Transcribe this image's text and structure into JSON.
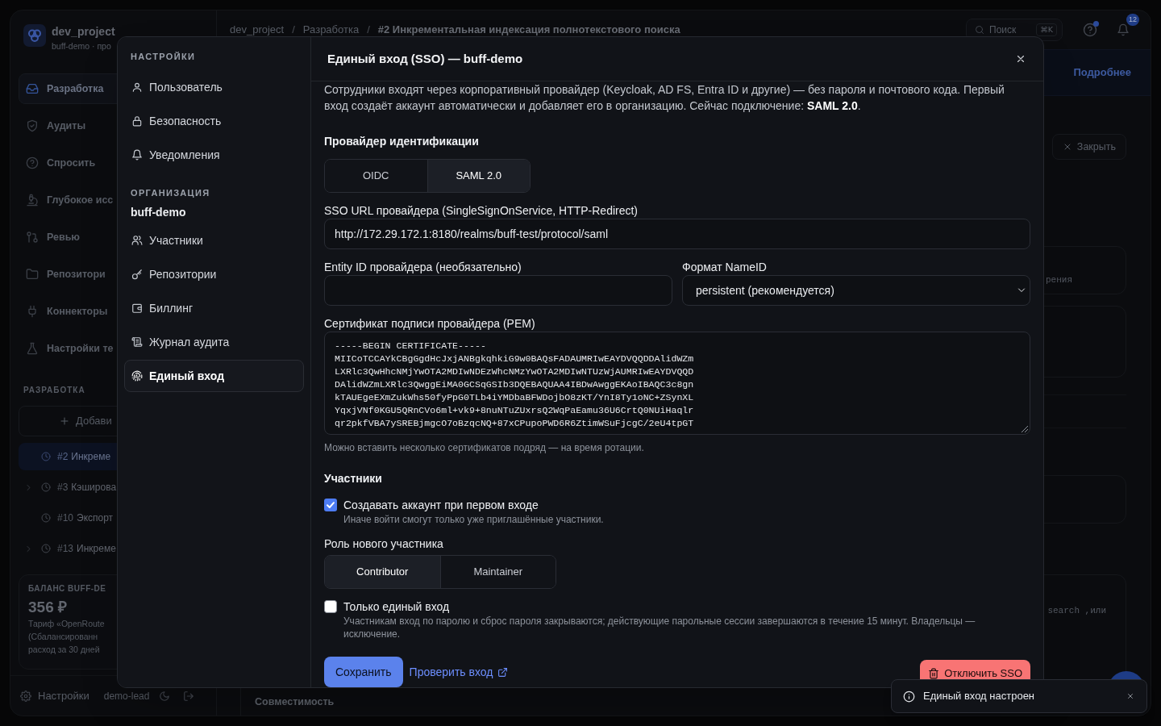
{
  "background": {
    "sidebar": {
      "project": {
        "name": "dev_project",
        "subtitle": "buff-demo · про"
      },
      "nav": [
        {
          "label": "Разработка",
          "selected": true
        },
        {
          "label": "Аудиты",
          "selected": false
        },
        {
          "label": "Спросить",
          "selected": false
        },
        {
          "label": "Глубокое исс",
          "selected": false
        },
        {
          "label": "Ревью",
          "selected": false
        },
        {
          "label": "Репозитори",
          "selected": false
        },
        {
          "label": "Коннекторы",
          "selected": false
        },
        {
          "label": "Настройки те",
          "selected": false
        }
      ],
      "section_title": "РАЗРАБОТКА",
      "add_button": "Добави",
      "tasks": [
        {
          "number": "#2",
          "title": "Инкреме",
          "selected": true,
          "expandable": false
        },
        {
          "number": "#3",
          "title": "Кэширова",
          "selected": false,
          "expandable": true
        },
        {
          "number": "#10",
          "title": "Экспорт",
          "selected": false,
          "expandable": false
        },
        {
          "number": "#13",
          "title": "Инкреме",
          "selected": false,
          "expandable": true
        }
      ],
      "balance": {
        "title": "БАЛАНС BUFF-DE",
        "amount": "356 ₽",
        "lines": [
          "Тариф «OpenRoute",
          "(Сбалансированн",
          "расход за 30 дней"
        ]
      },
      "footer": {
        "settings": "Настройки",
        "user": "demo-lead"
      }
    },
    "topbar": {
      "breadcrumbs": [
        "dev_project",
        "Разработка",
        "#2 Инкрементальная индексация полнотекстового поиска"
      ],
      "breadcrumb_separator": "/",
      "search": {
        "placeholder": "Поиск",
        "shortcut": "⌘K"
      },
      "help_unread": true,
      "notifications_count": "12"
    },
    "content": {
      "banner_link": "Подробнее",
      "close_button": "Закрыть",
      "card_fragments": [
        "рения",
        "search ,или"
      ],
      "bottom_tab": "Совместимость"
    }
  },
  "modal": {
    "sidebar": {
      "sections": [
        {
          "title": "НАСТРОЙКИ",
          "items": [
            {
              "label": "Пользователь",
              "selected": false
            },
            {
              "label": "Безопасность",
              "selected": false
            },
            {
              "label": "Уведомления",
              "selected": false
            }
          ]
        },
        {
          "title": "ОРГАНИЗАЦИЯ",
          "subtitle": "buff-demo",
          "items": [
            {
              "label": "Участники",
              "selected": false
            },
            {
              "label": "Репозитории",
              "selected": false
            },
            {
              "label": "Биллинг",
              "selected": false
            },
            {
              "label": "Журнал аудита",
              "selected": false
            },
            {
              "label": "Единый вход",
              "selected": true
            }
          ]
        }
      ]
    },
    "title": "Единый вход (SSO) — buff-demo",
    "description": "Сотрудники входят через корпоративный провайдер (Keycloak, AD FS, Entra ID и другие) — без пароля и почтового кода. Первый вход создаёт аккаунт автоматически и добавляет его в организацию. Сейчас подключение: **SAML 2.0**.",
    "provider": {
      "label": "Провайдер идентификации",
      "options": [
        {
          "label": "OIDC",
          "selected": false
        },
        {
          "label": "SAML 2.0",
          "selected": true
        }
      ]
    },
    "sso_url": {
      "label": "SSO URL провайдера (SingleSignOnService, HTTP-Redirect)",
      "value": "http://172.29.172.1:8180/realms/buff-test/protocol/saml"
    },
    "entity_id": {
      "label": "Entity ID провайдера (необязательно)"
    },
    "nameid_format": {
      "label": "Формат NameID",
      "value": "persistent (рекомендуется)"
    },
    "certificate": {
      "label": "Сертификат подписи провайдера (PEM)",
      "lines": [
        "-----BEGIN CERTIFICATE-----",
        "MIICoTCCAYkCBgGgdHcJxjANBgkqhkiG9w0BAQsFADAUMRIwEAYDVQQDDAlidWZm",
        "LXRlc3QwHhcNMjYwOTA2MDIwNDEzWhcNMzYwOTA2MDIwNTUzWjAUMRIwEAYDVQQD",
        "DAlidWZmLXRlc3QwggEiMA0GCSqGSIb3DQEBAQUAA4IBDwAwggEKAoIBAQC3c8gn",
        "kTAUEgeEXmZukWhs50fyPpG0TLb4iYMDbaBFWDojbO8zKT/YnI8Ty1oNC+ZSynXL",
        "YqxjVNf0KGU5QRnCVo6ml+vk9+8nuNTuZUxrsQ2WqPaEamu36U6CrtQ0NUiHaqlr",
        "qr2pkfVBA7ySREBjmgcO7oBzqcNQ+87xCPupoPWD6R6ZtimWSuFjcgC/2eU4tpGT"
      ],
      "hint": "Можно вставить несколько сертификатов подряд — на время ротации."
    },
    "members": {
      "title": "Участники",
      "auto_create": {
        "label": "Создавать аккаунт при первом входе",
        "hint": "Иначе войти смогут только уже приглашённые участники.",
        "checked": true
      },
      "role": {
        "label": "Роль нового участника",
        "options": [
          {
            "label": "Contributor",
            "selected": true
          },
          {
            "label": "Maintainer",
            "selected": false
          }
        ]
      },
      "sso_only": {
        "label": "Только единый вход",
        "hint": "Участникам вход по паролю и сброс пароля закрываются; действующие парольные сессии завершаются в течение 15 минут. Владельцы — исключение.",
        "checked": false
      }
    },
    "actions": {
      "save": "Сохранить",
      "test_link": "Проверить вход",
      "disable": "Отключить SSO"
    }
  },
  "toast": {
    "message": "Единый вход настроен"
  }
}
